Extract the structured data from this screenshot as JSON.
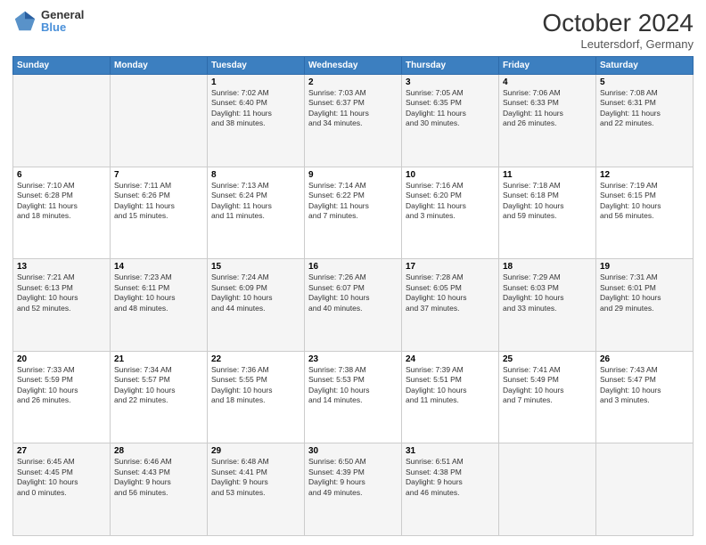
{
  "header": {
    "logo_line1": "General",
    "logo_line2": "Blue",
    "month": "October 2024",
    "location": "Leutersdorf, Germany"
  },
  "days_of_week": [
    "Sunday",
    "Monday",
    "Tuesday",
    "Wednesday",
    "Thursday",
    "Friday",
    "Saturday"
  ],
  "weeks": [
    [
      {
        "day": "",
        "content": ""
      },
      {
        "day": "",
        "content": ""
      },
      {
        "day": "1",
        "content": "Sunrise: 7:02 AM\nSunset: 6:40 PM\nDaylight: 11 hours\nand 38 minutes."
      },
      {
        "day": "2",
        "content": "Sunrise: 7:03 AM\nSunset: 6:37 PM\nDaylight: 11 hours\nand 34 minutes."
      },
      {
        "day": "3",
        "content": "Sunrise: 7:05 AM\nSunset: 6:35 PM\nDaylight: 11 hours\nand 30 minutes."
      },
      {
        "day": "4",
        "content": "Sunrise: 7:06 AM\nSunset: 6:33 PM\nDaylight: 11 hours\nand 26 minutes."
      },
      {
        "day": "5",
        "content": "Sunrise: 7:08 AM\nSunset: 6:31 PM\nDaylight: 11 hours\nand 22 minutes."
      }
    ],
    [
      {
        "day": "6",
        "content": "Sunrise: 7:10 AM\nSunset: 6:28 PM\nDaylight: 11 hours\nand 18 minutes."
      },
      {
        "day": "7",
        "content": "Sunrise: 7:11 AM\nSunset: 6:26 PM\nDaylight: 11 hours\nand 15 minutes."
      },
      {
        "day": "8",
        "content": "Sunrise: 7:13 AM\nSunset: 6:24 PM\nDaylight: 11 hours\nand 11 minutes."
      },
      {
        "day": "9",
        "content": "Sunrise: 7:14 AM\nSunset: 6:22 PM\nDaylight: 11 hours\nand 7 minutes."
      },
      {
        "day": "10",
        "content": "Sunrise: 7:16 AM\nSunset: 6:20 PM\nDaylight: 11 hours\nand 3 minutes."
      },
      {
        "day": "11",
        "content": "Sunrise: 7:18 AM\nSunset: 6:18 PM\nDaylight: 10 hours\nand 59 minutes."
      },
      {
        "day": "12",
        "content": "Sunrise: 7:19 AM\nSunset: 6:15 PM\nDaylight: 10 hours\nand 56 minutes."
      }
    ],
    [
      {
        "day": "13",
        "content": "Sunrise: 7:21 AM\nSunset: 6:13 PM\nDaylight: 10 hours\nand 52 minutes."
      },
      {
        "day": "14",
        "content": "Sunrise: 7:23 AM\nSunset: 6:11 PM\nDaylight: 10 hours\nand 48 minutes."
      },
      {
        "day": "15",
        "content": "Sunrise: 7:24 AM\nSunset: 6:09 PM\nDaylight: 10 hours\nand 44 minutes."
      },
      {
        "day": "16",
        "content": "Sunrise: 7:26 AM\nSunset: 6:07 PM\nDaylight: 10 hours\nand 40 minutes."
      },
      {
        "day": "17",
        "content": "Sunrise: 7:28 AM\nSunset: 6:05 PM\nDaylight: 10 hours\nand 37 minutes."
      },
      {
        "day": "18",
        "content": "Sunrise: 7:29 AM\nSunset: 6:03 PM\nDaylight: 10 hours\nand 33 minutes."
      },
      {
        "day": "19",
        "content": "Sunrise: 7:31 AM\nSunset: 6:01 PM\nDaylight: 10 hours\nand 29 minutes."
      }
    ],
    [
      {
        "day": "20",
        "content": "Sunrise: 7:33 AM\nSunset: 5:59 PM\nDaylight: 10 hours\nand 26 minutes."
      },
      {
        "day": "21",
        "content": "Sunrise: 7:34 AM\nSunset: 5:57 PM\nDaylight: 10 hours\nand 22 minutes."
      },
      {
        "day": "22",
        "content": "Sunrise: 7:36 AM\nSunset: 5:55 PM\nDaylight: 10 hours\nand 18 minutes."
      },
      {
        "day": "23",
        "content": "Sunrise: 7:38 AM\nSunset: 5:53 PM\nDaylight: 10 hours\nand 14 minutes."
      },
      {
        "day": "24",
        "content": "Sunrise: 7:39 AM\nSunset: 5:51 PM\nDaylight: 10 hours\nand 11 minutes."
      },
      {
        "day": "25",
        "content": "Sunrise: 7:41 AM\nSunset: 5:49 PM\nDaylight: 10 hours\nand 7 minutes."
      },
      {
        "day": "26",
        "content": "Sunrise: 7:43 AM\nSunset: 5:47 PM\nDaylight: 10 hours\nand 3 minutes."
      }
    ],
    [
      {
        "day": "27",
        "content": "Sunrise: 6:45 AM\nSunset: 4:45 PM\nDaylight: 10 hours\nand 0 minutes."
      },
      {
        "day": "28",
        "content": "Sunrise: 6:46 AM\nSunset: 4:43 PM\nDaylight: 9 hours\nand 56 minutes."
      },
      {
        "day": "29",
        "content": "Sunrise: 6:48 AM\nSunset: 4:41 PM\nDaylight: 9 hours\nand 53 minutes."
      },
      {
        "day": "30",
        "content": "Sunrise: 6:50 AM\nSunset: 4:39 PM\nDaylight: 9 hours\nand 49 minutes."
      },
      {
        "day": "31",
        "content": "Sunrise: 6:51 AM\nSunset: 4:38 PM\nDaylight: 9 hours\nand 46 minutes."
      },
      {
        "day": "",
        "content": ""
      },
      {
        "day": "",
        "content": ""
      }
    ]
  ]
}
